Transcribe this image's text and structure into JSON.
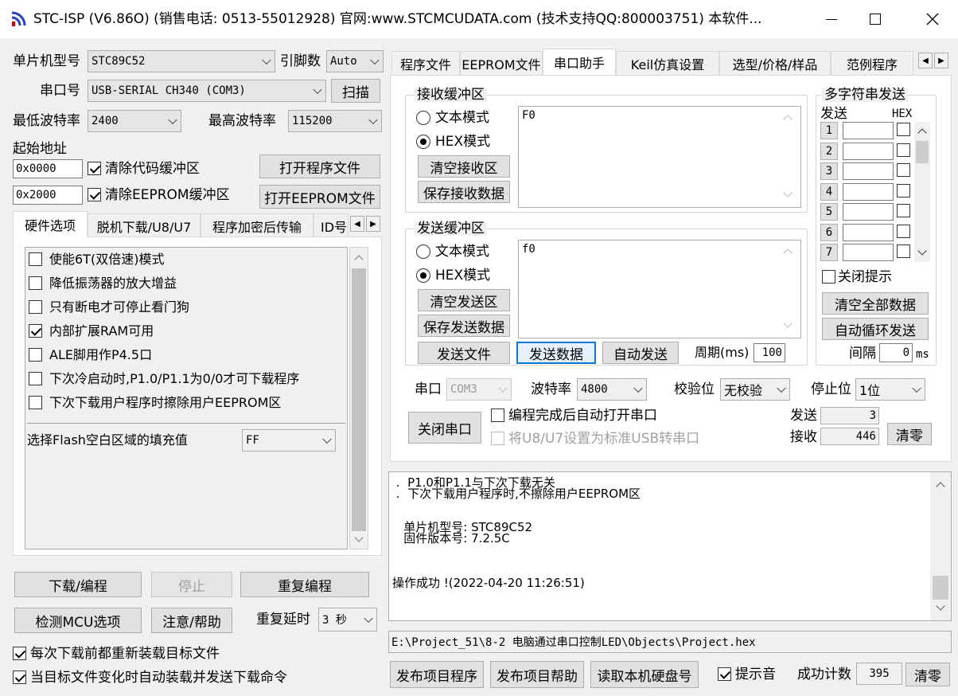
{
  "titlebar": {
    "title": "STC-ISP (V6.86O) (销售电话: 0513-55012928) 官网:www.STCMCUDATA.com  (技术支持QQ:800003751) 本软件...",
    "minimize": "—",
    "maximize": "☐",
    "close": "✕"
  },
  "left": {
    "mcu_label": "单片机型号",
    "mcu_value": "STC89C52",
    "pins_label": "引脚数",
    "pins_value": "Auto",
    "port_label": "串口号",
    "port_value": "USB-SERIAL CH340 (COM3)",
    "scan_button": "扫描",
    "min_baud_label": "最低波特率",
    "min_baud_value": "2400",
    "max_baud_label": "最高波特率",
    "max_baud_value": "115200",
    "start_addr_label": "起始地址",
    "addr1": "0x0000",
    "clear_code_label": "清除代码缓冲区",
    "open_program_button": "打开程序文件",
    "addr2": "0x2000",
    "clear_eeprom_label": "清除EEPROM缓冲区",
    "open_eeprom_button": "打开EEPROM文件",
    "tabs": [
      "硬件选项",
      "脱机下载/U8/U7",
      "程序加密后传输",
      "ID号"
    ],
    "options": [
      {
        "label": "使能6T(双倍速)模式",
        "checked": false
      },
      {
        "label": "降低振荡器的放大增益",
        "checked": false
      },
      {
        "label": "只有断电才可停止看门狗",
        "checked": false
      },
      {
        "label": "内部扩展RAM可用",
        "checked": true
      },
      {
        "label": "ALE脚用作P4.5口",
        "checked": false
      },
      {
        "label": "下次冷启动时,P1.0/P1.1为0/0才可下载程序",
        "checked": false
      },
      {
        "label": "下次下载用户程序时擦除用户EEPROM区",
        "checked": false
      }
    ],
    "flash_fill_label": "选择Flash空白区域的填充值",
    "flash_fill_value": "FF",
    "download_button": "下载/编程",
    "stop_button": "停止",
    "reprogram_button": "重复编程",
    "detect_button": "检测MCU选项",
    "help_button": "注意/帮助",
    "repeat_delay_label": "重复延时",
    "repeat_delay_value": "3 秒",
    "reload_label": "每次下载前都重新装载目标文件",
    "autoload_label": "当目标文件变化时自动装载并发送下载命令"
  },
  "right": {
    "tabs": [
      "程序文件",
      "EEPROM文件",
      "串口助手",
      "Keil仿真设置",
      "选型/价格/样品",
      "范例程序"
    ],
    "receive": {
      "title": "接收缓冲区",
      "text_mode": "文本模式",
      "hex_mode": "HEX模式",
      "clear_button": "清空接收区",
      "save_button": "保存接收数据",
      "content": "F0"
    },
    "send": {
      "title": "发送缓冲区",
      "text_mode": "文本模式",
      "hex_mode": "HEX模式",
      "clear_button": "清空发送区",
      "save_button": "保存发送数据",
      "content": "f0",
      "send_file_button": "发送文件",
      "send_data_button": "发送数据",
      "auto_send_button": "自动发送",
      "period_label": "周期(ms)",
      "period_value": "100"
    },
    "multi": {
      "title": "多字符串发送",
      "send_col": "发送",
      "hex_col": "HEX",
      "rows": [
        "1",
        "2",
        "3",
        "4",
        "5",
        "6",
        "7"
      ],
      "close_tip_label": "关闭提示",
      "clear_all_button": "清空全部数据",
      "auto_loop_button": "自动循环发送",
      "interval_label": "间隔",
      "interval_value": "0",
      "interval_unit": "ms"
    },
    "serial": {
      "port_label": "串口",
      "port_value": "COM3",
      "baud_label": "波特率",
      "baud_value": "4800",
      "parity_label": "校验位",
      "parity_value": "无校验",
      "stop_label": "停止位",
      "stop_value": "1位",
      "close_port_button": "关闭串口",
      "auto_open_label": "编程完成后自动打开串口",
      "usb_label": "将U8/U7设置为标准USB转串口",
      "sent_label": "发送",
      "sent_value": "3",
      "recv_label": "接收",
      "recv_value": "446",
      "clear_button": "清零"
    },
    "log": {
      "lines": [
        " .  P1.0和P1.1与下次下载无关",
        " .  下次下载用户程序时,不擦除用户EEPROM区",
        "",
        "",
        "   单片机型号: STC89C52",
        "   固件版本号: 7.2.5C",
        "",
        "",
        "",
        "操作成功 !(2022-04-20 11:26:51)"
      ]
    },
    "path": "E:\\Project_51\\8-2 电脑通过串口控制LED\\Objects\\Project.hex",
    "publish_program_button": "发布项目程序",
    "publish_help_button": "发布项目帮助",
    "read_disk_button": "读取本机硬盘号",
    "sound_label": "提示音",
    "success_count_label": "成功计数",
    "success_count_value": "395",
    "clear_count_button": "清零"
  }
}
